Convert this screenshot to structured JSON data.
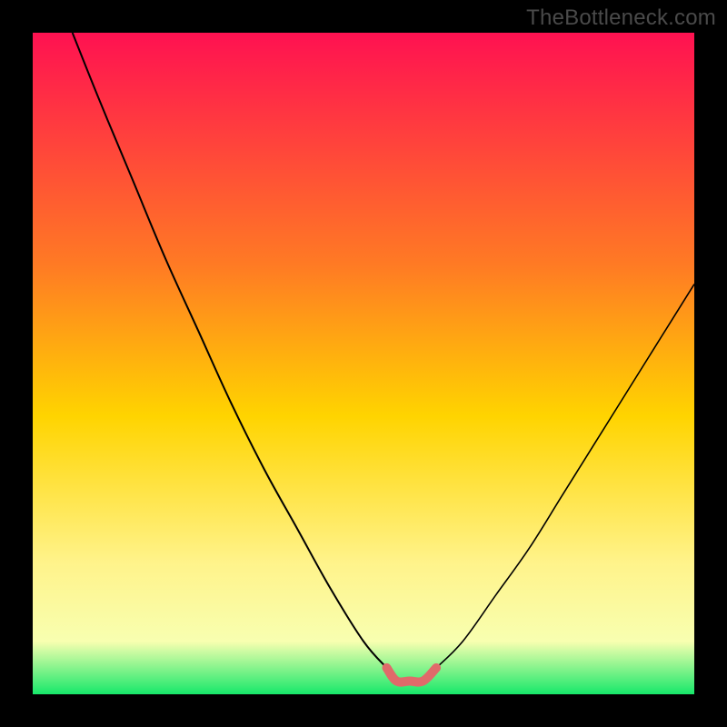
{
  "watermark": "TheBottleneck.com",
  "colors": {
    "frame": "#000000",
    "watermark": "#4a4a4a",
    "gradient_top": "#ff1151",
    "gradient_mid1": "#ff7a24",
    "gradient_mid2": "#ffd400",
    "gradient_mid3": "#fff38a",
    "gradient_mid4": "#f8ffb0",
    "gradient_bottom": "#17e86a",
    "curve_stroke": "#000000",
    "highlight_stroke": "#e06a6a"
  },
  "chart_data": {
    "type": "line",
    "title": "",
    "xlabel": "",
    "ylabel": "",
    "xlim": [
      0,
      100
    ],
    "ylim": [
      0,
      100
    ],
    "legend": false,
    "grid": false,
    "annotations": [],
    "series": [
      {
        "name": "left-curve",
        "x": [
          6,
          10,
          15,
          20,
          25,
          30,
          35,
          40,
          45,
          50,
          53.5
        ],
        "y": [
          100,
          90,
          78,
          66,
          55,
          44,
          34,
          25,
          16,
          8,
          4
        ]
      },
      {
        "name": "right-curve",
        "x": [
          61,
          65,
          70,
          75,
          80,
          85,
          90,
          95,
          100
        ],
        "y": [
          4,
          8,
          15,
          22,
          30,
          38,
          46,
          54,
          62
        ]
      },
      {
        "name": "floor-highlight",
        "x": [
          53.5,
          55,
          57,
          59,
          61
        ],
        "y": [
          4,
          2,
          2,
          2,
          4
        ]
      }
    ]
  }
}
